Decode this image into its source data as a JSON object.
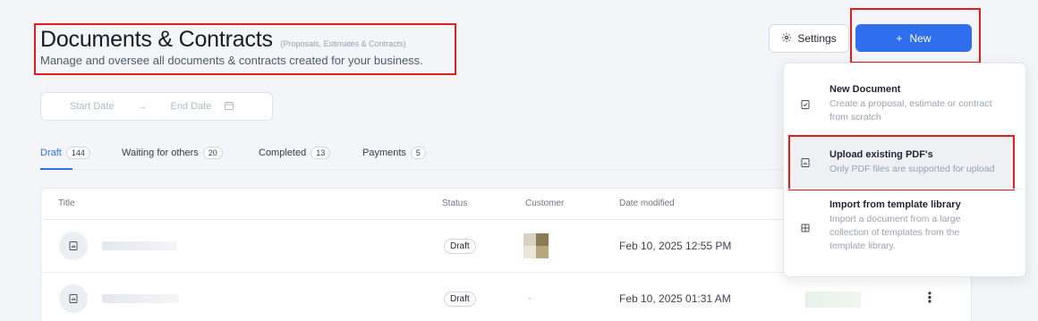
{
  "header": {
    "title": "Documents & Contracts",
    "title_suffix": "(Proposals, Estimates & Contracts)",
    "description": "Manage and oversee all documents & contracts created for your business.",
    "settings_label": "Settings",
    "settings_icon": "gear-icon",
    "new_label": "New",
    "new_icon": "plus-icon"
  },
  "date_range": {
    "start_placeholder": "Start Date",
    "arrow": "→",
    "end_placeholder": "End Date",
    "calendar_icon": "calendar-icon"
  },
  "tabs": [
    {
      "label": "Draft",
      "count": "144",
      "active": true
    },
    {
      "label": "Waiting for others",
      "count": "20",
      "active": false
    },
    {
      "label": "Completed",
      "count": "13",
      "active": false
    },
    {
      "label": "Payments",
      "count": "5",
      "active": false
    }
  ],
  "table": {
    "columns": [
      "Title",
      "Status",
      "Customer",
      "Date modified"
    ],
    "rows": [
      {
        "status": "Draft",
        "customer": "",
        "date_modified": "Feb 10, 2025 12:55 PM"
      },
      {
        "status": "Draft",
        "customer": "-",
        "date_modified": "Feb 10, 2025 01:31 AM"
      }
    ],
    "row_menu_glyph": "⋮"
  },
  "new_menu": {
    "items": [
      {
        "title": "New Document",
        "description": "Create a proposal, estimate or contract from scratch",
        "icon": "document-check-icon"
      },
      {
        "title": "Upload existing PDF's",
        "description": "Only PDF files are supported for upload",
        "icon": "pdf-file-icon"
      },
      {
        "title": "Import from template library",
        "description": "Import a document from a large collection of templates from the template library.",
        "icon": "template-library-icon"
      }
    ]
  },
  "colors": {
    "accent": "#2f6fed",
    "highlight_outline": "#e11d1d",
    "background": "#f3f5f8"
  }
}
